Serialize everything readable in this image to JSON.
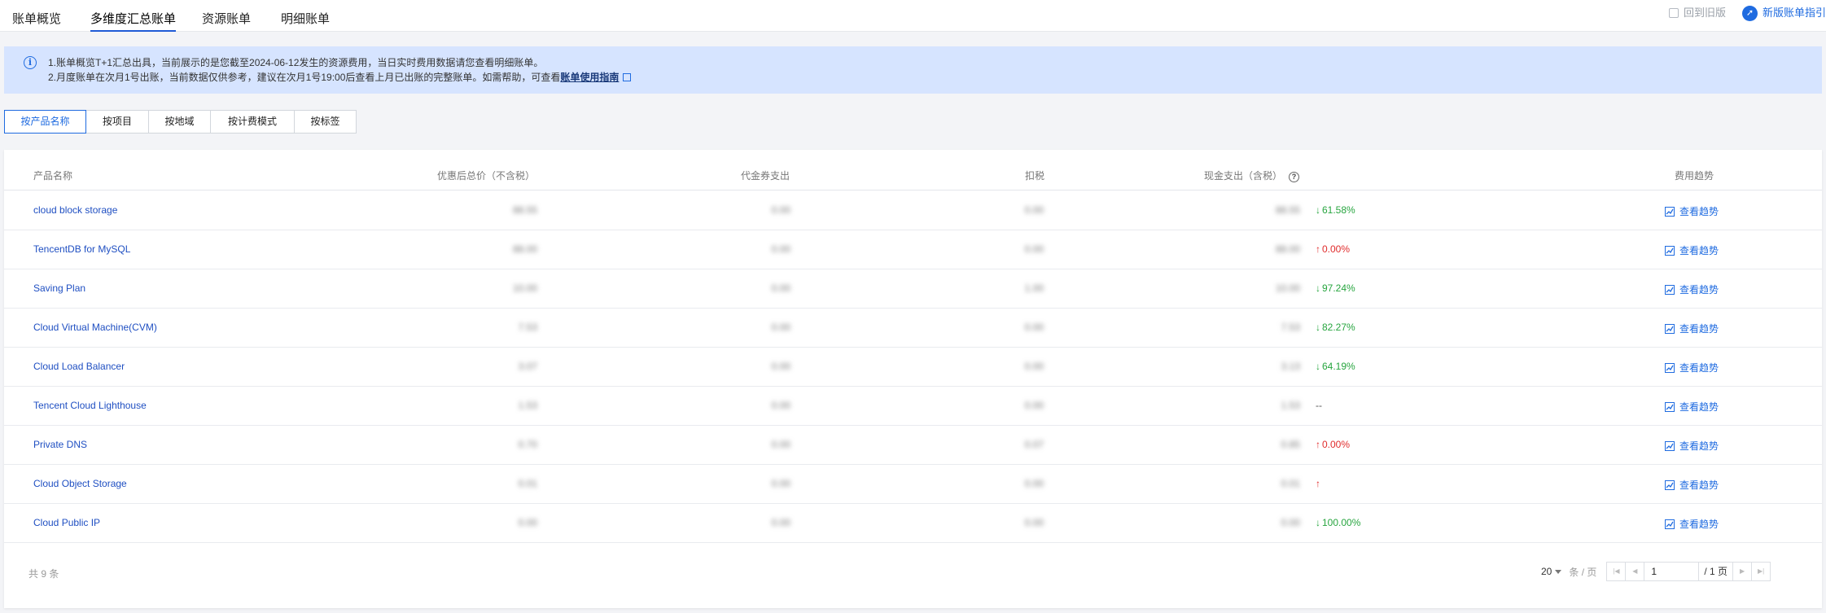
{
  "nav": {
    "tabs": [
      "账单概览",
      "多维度汇总账单",
      "资源账单",
      "明细账单"
    ],
    "active_tab": 1,
    "back_old": "回到旧版",
    "new_guide": "新版账单指引"
  },
  "notice": {
    "line1": "1.账单概览T+1汇总出具，当前展示的是您截至2024-06-12发生的资源费用，当日实时费用数据请您查看明细账单。",
    "line2_prefix": "2.月度账单在次月1号出账，当前数据仅供参考，建议在次月1号19:00后查看上月已出账的完整账单。如需帮助，可查看",
    "line2_link": "账单使用指南"
  },
  "dimension_tabs": [
    "按产品名称",
    "按项目",
    "按地域",
    "按计费模式",
    "按标签"
  ],
  "table": {
    "headers": {
      "product": "产品名称",
      "discount_total": "优惠后总价（不含税）",
      "voucher": "代金券支出",
      "tax": "扣税",
      "cash": "现金支出（含税）",
      "trend": "费用趋势"
    },
    "view_trend_label": "查看趋势",
    "rows": [
      {
        "name": "cloud block storage",
        "discount_total": "88.55",
        "voucher": "0.00",
        "tax": "0.00",
        "cash": "88.55",
        "trend": "61.58%",
        "direction": "down"
      },
      {
        "name": "TencentDB for MySQL",
        "discount_total": "88.00",
        "voucher": "0.00",
        "tax": "0.00",
        "cash": "88.00",
        "trend": "0.00%",
        "direction": "up"
      },
      {
        "name": "Saving Plan",
        "discount_total": "10.00",
        "voucher": "0.00",
        "tax": "1.00",
        "cash": "10.00",
        "trend": "97.24%",
        "direction": "down"
      },
      {
        "name": "Cloud Virtual Machine(CVM)",
        "discount_total": "7.53",
        "voucher": "0.00",
        "tax": "0.00",
        "cash": "7.53",
        "trend": "82.27%",
        "direction": "down"
      },
      {
        "name": "Cloud Load Balancer",
        "discount_total": "3.07",
        "voucher": "0.00",
        "tax": "0.00",
        "cash": "3.13",
        "trend": "64.19%",
        "direction": "down"
      },
      {
        "name": "Tencent Cloud Lighthouse",
        "discount_total": "1.53",
        "voucher": "0.00",
        "tax": "0.00",
        "cash": "1.53",
        "trend": "--",
        "direction": "none"
      },
      {
        "name": "Private DNS",
        "discount_total": "0.70",
        "voucher": "0.00",
        "tax": "0.07",
        "cash": "0.85",
        "trend": "0.00%",
        "direction": "up"
      },
      {
        "name": "Cloud Object Storage",
        "discount_total": "0.01",
        "voucher": "0.00",
        "tax": "0.00",
        "cash": "0.01",
        "trend": "",
        "direction": "up"
      },
      {
        "name": "Cloud Public IP",
        "discount_total": "0.00",
        "voucher": "0.00",
        "tax": "0.00",
        "cash": "0.00",
        "trend": "100.00%",
        "direction": "down"
      }
    ]
  },
  "footer": {
    "total": "共 9 条",
    "page_size": "20",
    "per_page": "条 / 页",
    "page_input": "1",
    "page_total": "/ 1 页"
  },
  "colors": {
    "accent": "#1f6be0",
    "down": "#27a53f",
    "up": "#e02c2c",
    "notice_bg": "#d6e4ff"
  }
}
